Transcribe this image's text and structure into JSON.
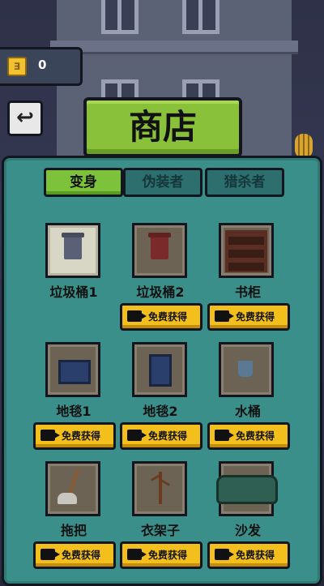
{
  "coins": {
    "count": "0",
    "icon": "coin-icon"
  },
  "header": {
    "title": "商店",
    "back_icon": "back-arrow-icon"
  },
  "tabs": [
    {
      "label": "变身",
      "active": true
    },
    {
      "label": "伪装者",
      "active": false
    },
    {
      "label": "猎杀者",
      "active": false
    }
  ],
  "items": [
    {
      "name": "垃圾桶1",
      "owned": true,
      "button": ""
    },
    {
      "name": "垃圾桶2",
      "owned": false,
      "button": "免费获得"
    },
    {
      "name": "书柜",
      "owned": false,
      "button": "免费获得"
    },
    {
      "name": "地毯1",
      "owned": false,
      "button": "免费获得"
    },
    {
      "name": "地毯2",
      "owned": false,
      "button": "免费获得"
    },
    {
      "name": "水桶",
      "owned": false,
      "button": "免费获得"
    },
    {
      "name": "拖把",
      "owned": false,
      "button": "免费获得"
    },
    {
      "name": "衣架子",
      "owned": false,
      "button": "免费获得"
    },
    {
      "name": "沙发",
      "owned": false,
      "button": "免费获得"
    }
  ],
  "colors": {
    "panel": "#3b8f8a",
    "active_tab": "#7cc23a",
    "button": "#f3bf1c",
    "title_banner": "#8ac13a"
  }
}
